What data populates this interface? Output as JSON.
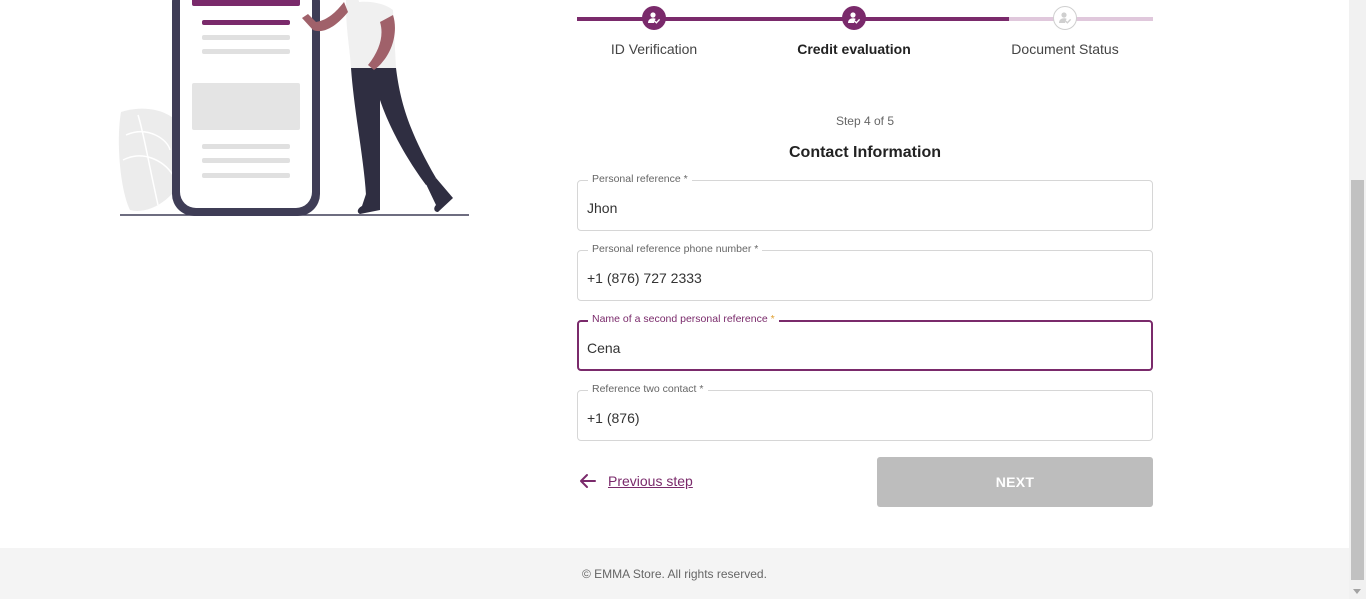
{
  "stepper": {
    "steps": [
      {
        "label": "ID Verification",
        "status": "done"
      },
      {
        "label": "Credit evaluation",
        "status": "active"
      },
      {
        "label": "Document Status",
        "status": "todo"
      }
    ]
  },
  "form": {
    "step_count": "Step 4 of 5",
    "title": "Contact Information",
    "fields": [
      {
        "label": "Personal reference",
        "required": "*",
        "value": "Jhon"
      },
      {
        "label": "Personal reference phone number",
        "required": "*",
        "value": "+1 (876) 727 2333"
      },
      {
        "label": "Name of a second personal reference",
        "required": "*",
        "value": "Cena"
      },
      {
        "label": "Reference two contact",
        "required": "*",
        "value": "+1 (876)"
      }
    ],
    "previous_label": "Previous step",
    "next_label": "NEXT"
  },
  "footer": {
    "text": "© EMMA Store. All rights reserved."
  },
  "colors": {
    "accent": "#7a2a6b",
    "accent_light": "#e0c8dc",
    "button_disabled": "#bdbdbd",
    "footer_bg": "#f4f4f4"
  },
  "icons": {
    "step_done": "user-check-icon",
    "step_todo": "user-check-icon",
    "previous": "arrow-left-icon"
  }
}
